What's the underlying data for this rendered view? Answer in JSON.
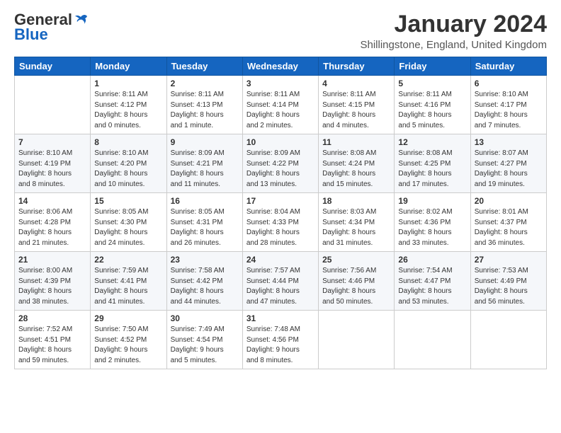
{
  "logo": {
    "line1": "General",
    "line2": "Blue"
  },
  "title": "January 2024",
  "location": "Shillingstone, England, United Kingdom",
  "weekdays": [
    "Sunday",
    "Monday",
    "Tuesday",
    "Wednesday",
    "Thursday",
    "Friday",
    "Saturday"
  ],
  "weeks": [
    [
      {
        "day": "",
        "sunrise": "",
        "sunset": "",
        "daylight": ""
      },
      {
        "day": "1",
        "sunrise": "Sunrise: 8:11 AM",
        "sunset": "Sunset: 4:12 PM",
        "daylight": "Daylight: 8 hours and 0 minutes."
      },
      {
        "day": "2",
        "sunrise": "Sunrise: 8:11 AM",
        "sunset": "Sunset: 4:13 PM",
        "daylight": "Daylight: 8 hours and 1 minute."
      },
      {
        "day": "3",
        "sunrise": "Sunrise: 8:11 AM",
        "sunset": "Sunset: 4:14 PM",
        "daylight": "Daylight: 8 hours and 2 minutes."
      },
      {
        "day": "4",
        "sunrise": "Sunrise: 8:11 AM",
        "sunset": "Sunset: 4:15 PM",
        "daylight": "Daylight: 8 hours and 4 minutes."
      },
      {
        "day": "5",
        "sunrise": "Sunrise: 8:11 AM",
        "sunset": "Sunset: 4:16 PM",
        "daylight": "Daylight: 8 hours and 5 minutes."
      },
      {
        "day": "6",
        "sunrise": "Sunrise: 8:10 AM",
        "sunset": "Sunset: 4:17 PM",
        "daylight": "Daylight: 8 hours and 7 minutes."
      }
    ],
    [
      {
        "day": "7",
        "sunrise": "Sunrise: 8:10 AM",
        "sunset": "Sunset: 4:19 PM",
        "daylight": "Daylight: 8 hours and 8 minutes."
      },
      {
        "day": "8",
        "sunrise": "Sunrise: 8:10 AM",
        "sunset": "Sunset: 4:20 PM",
        "daylight": "Daylight: 8 hours and 10 minutes."
      },
      {
        "day": "9",
        "sunrise": "Sunrise: 8:09 AM",
        "sunset": "Sunset: 4:21 PM",
        "daylight": "Daylight: 8 hours and 11 minutes."
      },
      {
        "day": "10",
        "sunrise": "Sunrise: 8:09 AM",
        "sunset": "Sunset: 4:22 PM",
        "daylight": "Daylight: 8 hours and 13 minutes."
      },
      {
        "day": "11",
        "sunrise": "Sunrise: 8:08 AM",
        "sunset": "Sunset: 4:24 PM",
        "daylight": "Daylight: 8 hours and 15 minutes."
      },
      {
        "day": "12",
        "sunrise": "Sunrise: 8:08 AM",
        "sunset": "Sunset: 4:25 PM",
        "daylight": "Daylight: 8 hours and 17 minutes."
      },
      {
        "day": "13",
        "sunrise": "Sunrise: 8:07 AM",
        "sunset": "Sunset: 4:27 PM",
        "daylight": "Daylight: 8 hours and 19 minutes."
      }
    ],
    [
      {
        "day": "14",
        "sunrise": "Sunrise: 8:06 AM",
        "sunset": "Sunset: 4:28 PM",
        "daylight": "Daylight: 8 hours and 21 minutes."
      },
      {
        "day": "15",
        "sunrise": "Sunrise: 8:05 AM",
        "sunset": "Sunset: 4:30 PM",
        "daylight": "Daylight: 8 hours and 24 minutes."
      },
      {
        "day": "16",
        "sunrise": "Sunrise: 8:05 AM",
        "sunset": "Sunset: 4:31 PM",
        "daylight": "Daylight: 8 hours and 26 minutes."
      },
      {
        "day": "17",
        "sunrise": "Sunrise: 8:04 AM",
        "sunset": "Sunset: 4:33 PM",
        "daylight": "Daylight: 8 hours and 28 minutes."
      },
      {
        "day": "18",
        "sunrise": "Sunrise: 8:03 AM",
        "sunset": "Sunset: 4:34 PM",
        "daylight": "Daylight: 8 hours and 31 minutes."
      },
      {
        "day": "19",
        "sunrise": "Sunrise: 8:02 AM",
        "sunset": "Sunset: 4:36 PM",
        "daylight": "Daylight: 8 hours and 33 minutes."
      },
      {
        "day": "20",
        "sunrise": "Sunrise: 8:01 AM",
        "sunset": "Sunset: 4:37 PM",
        "daylight": "Daylight: 8 hours and 36 minutes."
      }
    ],
    [
      {
        "day": "21",
        "sunrise": "Sunrise: 8:00 AM",
        "sunset": "Sunset: 4:39 PM",
        "daylight": "Daylight: 8 hours and 38 minutes."
      },
      {
        "day": "22",
        "sunrise": "Sunrise: 7:59 AM",
        "sunset": "Sunset: 4:41 PM",
        "daylight": "Daylight: 8 hours and 41 minutes."
      },
      {
        "day": "23",
        "sunrise": "Sunrise: 7:58 AM",
        "sunset": "Sunset: 4:42 PM",
        "daylight": "Daylight: 8 hours and 44 minutes."
      },
      {
        "day": "24",
        "sunrise": "Sunrise: 7:57 AM",
        "sunset": "Sunset: 4:44 PM",
        "daylight": "Daylight: 8 hours and 47 minutes."
      },
      {
        "day": "25",
        "sunrise": "Sunrise: 7:56 AM",
        "sunset": "Sunset: 4:46 PM",
        "daylight": "Daylight: 8 hours and 50 minutes."
      },
      {
        "day": "26",
        "sunrise": "Sunrise: 7:54 AM",
        "sunset": "Sunset: 4:47 PM",
        "daylight": "Daylight: 8 hours and 53 minutes."
      },
      {
        "day": "27",
        "sunrise": "Sunrise: 7:53 AM",
        "sunset": "Sunset: 4:49 PM",
        "daylight": "Daylight: 8 hours and 56 minutes."
      }
    ],
    [
      {
        "day": "28",
        "sunrise": "Sunrise: 7:52 AM",
        "sunset": "Sunset: 4:51 PM",
        "daylight": "Daylight: 8 hours and 59 minutes."
      },
      {
        "day": "29",
        "sunrise": "Sunrise: 7:50 AM",
        "sunset": "Sunset: 4:52 PM",
        "daylight": "Daylight: 9 hours and 2 minutes."
      },
      {
        "day": "30",
        "sunrise": "Sunrise: 7:49 AM",
        "sunset": "Sunset: 4:54 PM",
        "daylight": "Daylight: 9 hours and 5 minutes."
      },
      {
        "day": "31",
        "sunrise": "Sunrise: 7:48 AM",
        "sunset": "Sunset: 4:56 PM",
        "daylight": "Daylight: 9 hours and 8 minutes."
      },
      {
        "day": "",
        "sunrise": "",
        "sunset": "",
        "daylight": ""
      },
      {
        "day": "",
        "sunrise": "",
        "sunset": "",
        "daylight": ""
      },
      {
        "day": "",
        "sunrise": "",
        "sunset": "",
        "daylight": ""
      }
    ]
  ]
}
